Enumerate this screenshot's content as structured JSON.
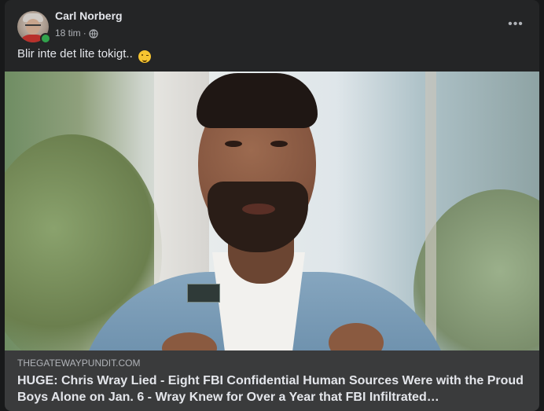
{
  "post": {
    "author": "Carl Norberg",
    "time": "18 tim",
    "separator": "·",
    "privacy_icon": "globe-icon",
    "text": "Blir inte det lite tokigt..",
    "emoji": "winking-face-emoji",
    "more_label": "•••"
  },
  "link": {
    "domain": "THEGATEWAYPUNDIT.COM",
    "title": "HUGE: Chris Wray Lied - Eight FBI Confidential Human Sources Were with the Proud Boys Alone on Jan. 6 - Wray Knew for Over a Year that FBI Infiltrated…"
  },
  "colors": {
    "card_bg": "#242526",
    "link_info_bg": "#3a3b3c",
    "primary_text": "#e4e6eb",
    "secondary_text": "#b0b3b8",
    "online": "#31a24c"
  }
}
